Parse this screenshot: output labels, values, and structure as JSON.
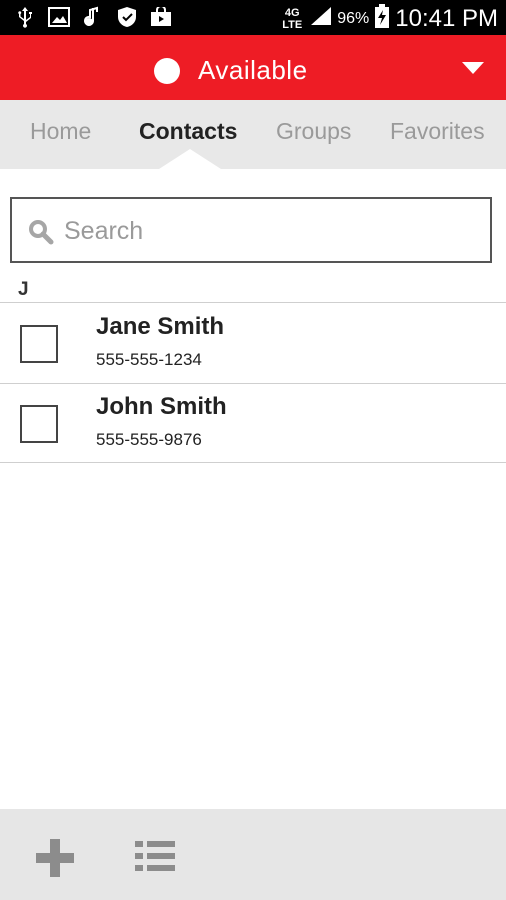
{
  "status_bar": {
    "icons": [
      "usb-icon",
      "image-icon",
      "music-icon",
      "shield-icon",
      "store-bag-icon"
    ],
    "network": "4G LTE",
    "battery_percent": "96%",
    "time": "10:41 PM"
  },
  "header": {
    "presence_label": "Available",
    "presence_color": "#ffffff",
    "bar_color": "#ee1c25"
  },
  "tabs": [
    {
      "label": "Home",
      "active": false
    },
    {
      "label": "Contacts",
      "active": true
    },
    {
      "label": "Groups",
      "active": false
    },
    {
      "label": "Favorites",
      "active": false
    }
  ],
  "search": {
    "placeholder": "Search",
    "value": ""
  },
  "contacts": {
    "section_letter": "J",
    "items": [
      {
        "name": "Jane Smith",
        "phone": "555-555-1234",
        "checked": false
      },
      {
        "name": "John Smith",
        "phone": "555-555-9876",
        "checked": false
      }
    ]
  },
  "footer": {
    "actions": [
      "add-icon",
      "list-icon"
    ]
  }
}
